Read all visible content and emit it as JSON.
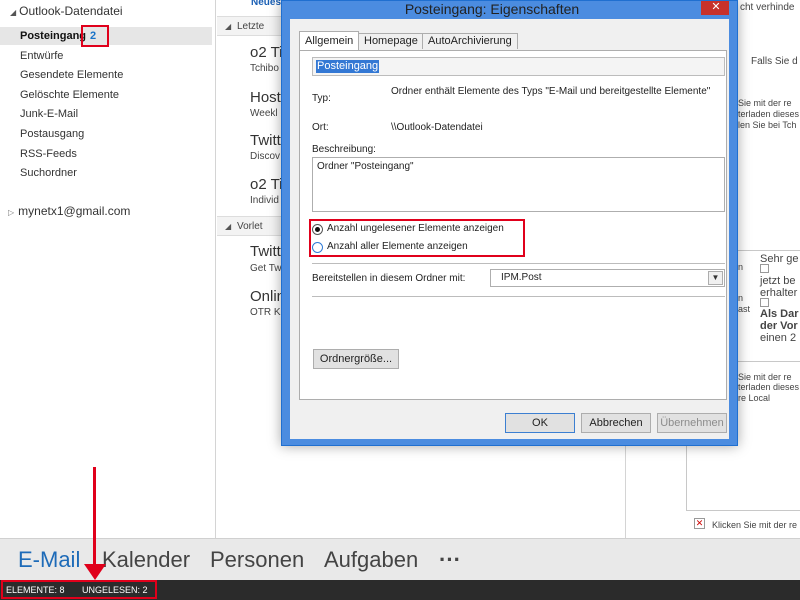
{
  "folder_pane": {
    "root_label": "Outlook-Datendatei",
    "folders": [
      {
        "label": "Posteingang",
        "count": "2"
      },
      {
        "label": "Entwürfe"
      },
      {
        "label": "Gesendete Elemente"
      },
      {
        "label": "Gelöschte Elemente"
      },
      {
        "label": "Junk-E-Mail"
      },
      {
        "label": "Postausgang"
      },
      {
        "label": "RSS-Feeds"
      },
      {
        "label": "Suchordner"
      }
    ],
    "account": "mynetx1@gmail.com"
  },
  "message_list": {
    "top_link": "Neues",
    "groups": [
      "Letzte",
      "Vorlet"
    ],
    "messages": [
      {
        "sender": "o2 Ti",
        "preview": "Tchibo"
      },
      {
        "sender": "Host",
        "preview": "Weekl"
      },
      {
        "sender": "Twitt",
        "preview": "Discov"
      },
      {
        "sender": "o2 Ti",
        "preview": "Individ"
      },
      {
        "sender": "Twitt",
        "preview": "Get Tw"
      },
      {
        "sender": "Onlin",
        "preview": "OTR Kr"
      }
    ]
  },
  "reading_pane": {
    "top": "cht verhinde",
    "falls": "Falls Sie d",
    "note1": [
      "Sie mit der re",
      "terladen dieses",
      "len Sie bei Tch"
    ],
    "body_lines": [
      "Sehr ge",
      "jetzt be",
      "erhalter",
      "Als Dar",
      "der Vor",
      "einen 2"
    ],
    "left_fragments": [
      "n",
      "n",
      "ast"
    ],
    "note2": [
      "Sie mit der re",
      "terladen dieses",
      "re Local"
    ],
    "bottom": "Klicken Sie mit der re"
  },
  "nav_bar": {
    "items": [
      "E-Mail",
      "Kalender",
      "Personen",
      "Aufgaben",
      "···"
    ]
  },
  "status_bar": {
    "elements": "ELEMENTE: 8",
    "unread": "UNGELESEN: 2"
  },
  "dialog": {
    "title": "Posteingang: Eigenschaften",
    "close": "✕",
    "tabs": [
      "Allgemein",
      "Homepage",
      "AutoArchivierung"
    ],
    "folder_name": "Posteingang",
    "type_label": "Typ:",
    "type_value": "Ordner enthält Elemente des Typs \"E-Mail und bereitgestellte Elemente\"",
    "location_label": "Ort:",
    "location_value": "\\\\Outlook-Datendatei",
    "description_label": "Beschreibung:",
    "description_value": "Ordner \"Posteingang\"",
    "radio_unread": "Anzahl ungelesener Elemente anzeigen",
    "radio_all": "Anzahl aller Elemente anzeigen",
    "post_label": "Bereitstellen in diesem Ordner mit:",
    "post_value": "IPM.Post",
    "folder_size_button": "Ordnergröße...",
    "ok": "OK",
    "cancel": "Abbrechen",
    "apply": "Übernehmen"
  }
}
